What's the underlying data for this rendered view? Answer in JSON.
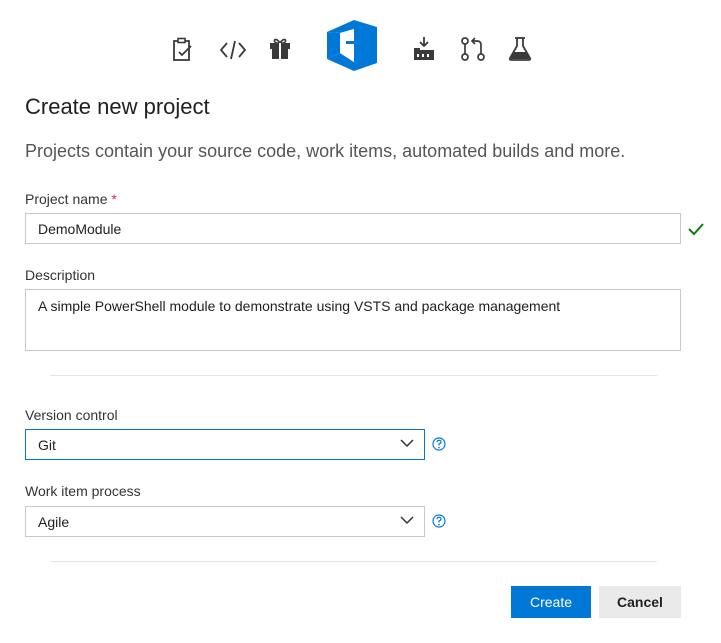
{
  "header": {
    "icons": [
      "boards-icon",
      "code-icon",
      "gift-icon",
      "vsts-logo-icon",
      "build-icon",
      "pull-request-icon",
      "test-flask-icon"
    ]
  },
  "page": {
    "title": "Create new project",
    "subtitle": "Projects contain your source code, work items, automated builds and more."
  },
  "form": {
    "project_name": {
      "label": "Project name",
      "required_marker": "*",
      "value": "DemoModule"
    },
    "description": {
      "label": "Description",
      "value": "A simple PowerShell module to demonstrate using VSTS and package management"
    },
    "version_control": {
      "label": "Version control",
      "value": "Git"
    },
    "work_item_process": {
      "label": "Work item process",
      "value": "Agile"
    }
  },
  "actions": {
    "create_label": "Create",
    "cancel_label": "Cancel"
  },
  "colors": {
    "accent": "#0078d7",
    "valid_check": "#107c10",
    "icon_gray": "#3a3a3a"
  }
}
